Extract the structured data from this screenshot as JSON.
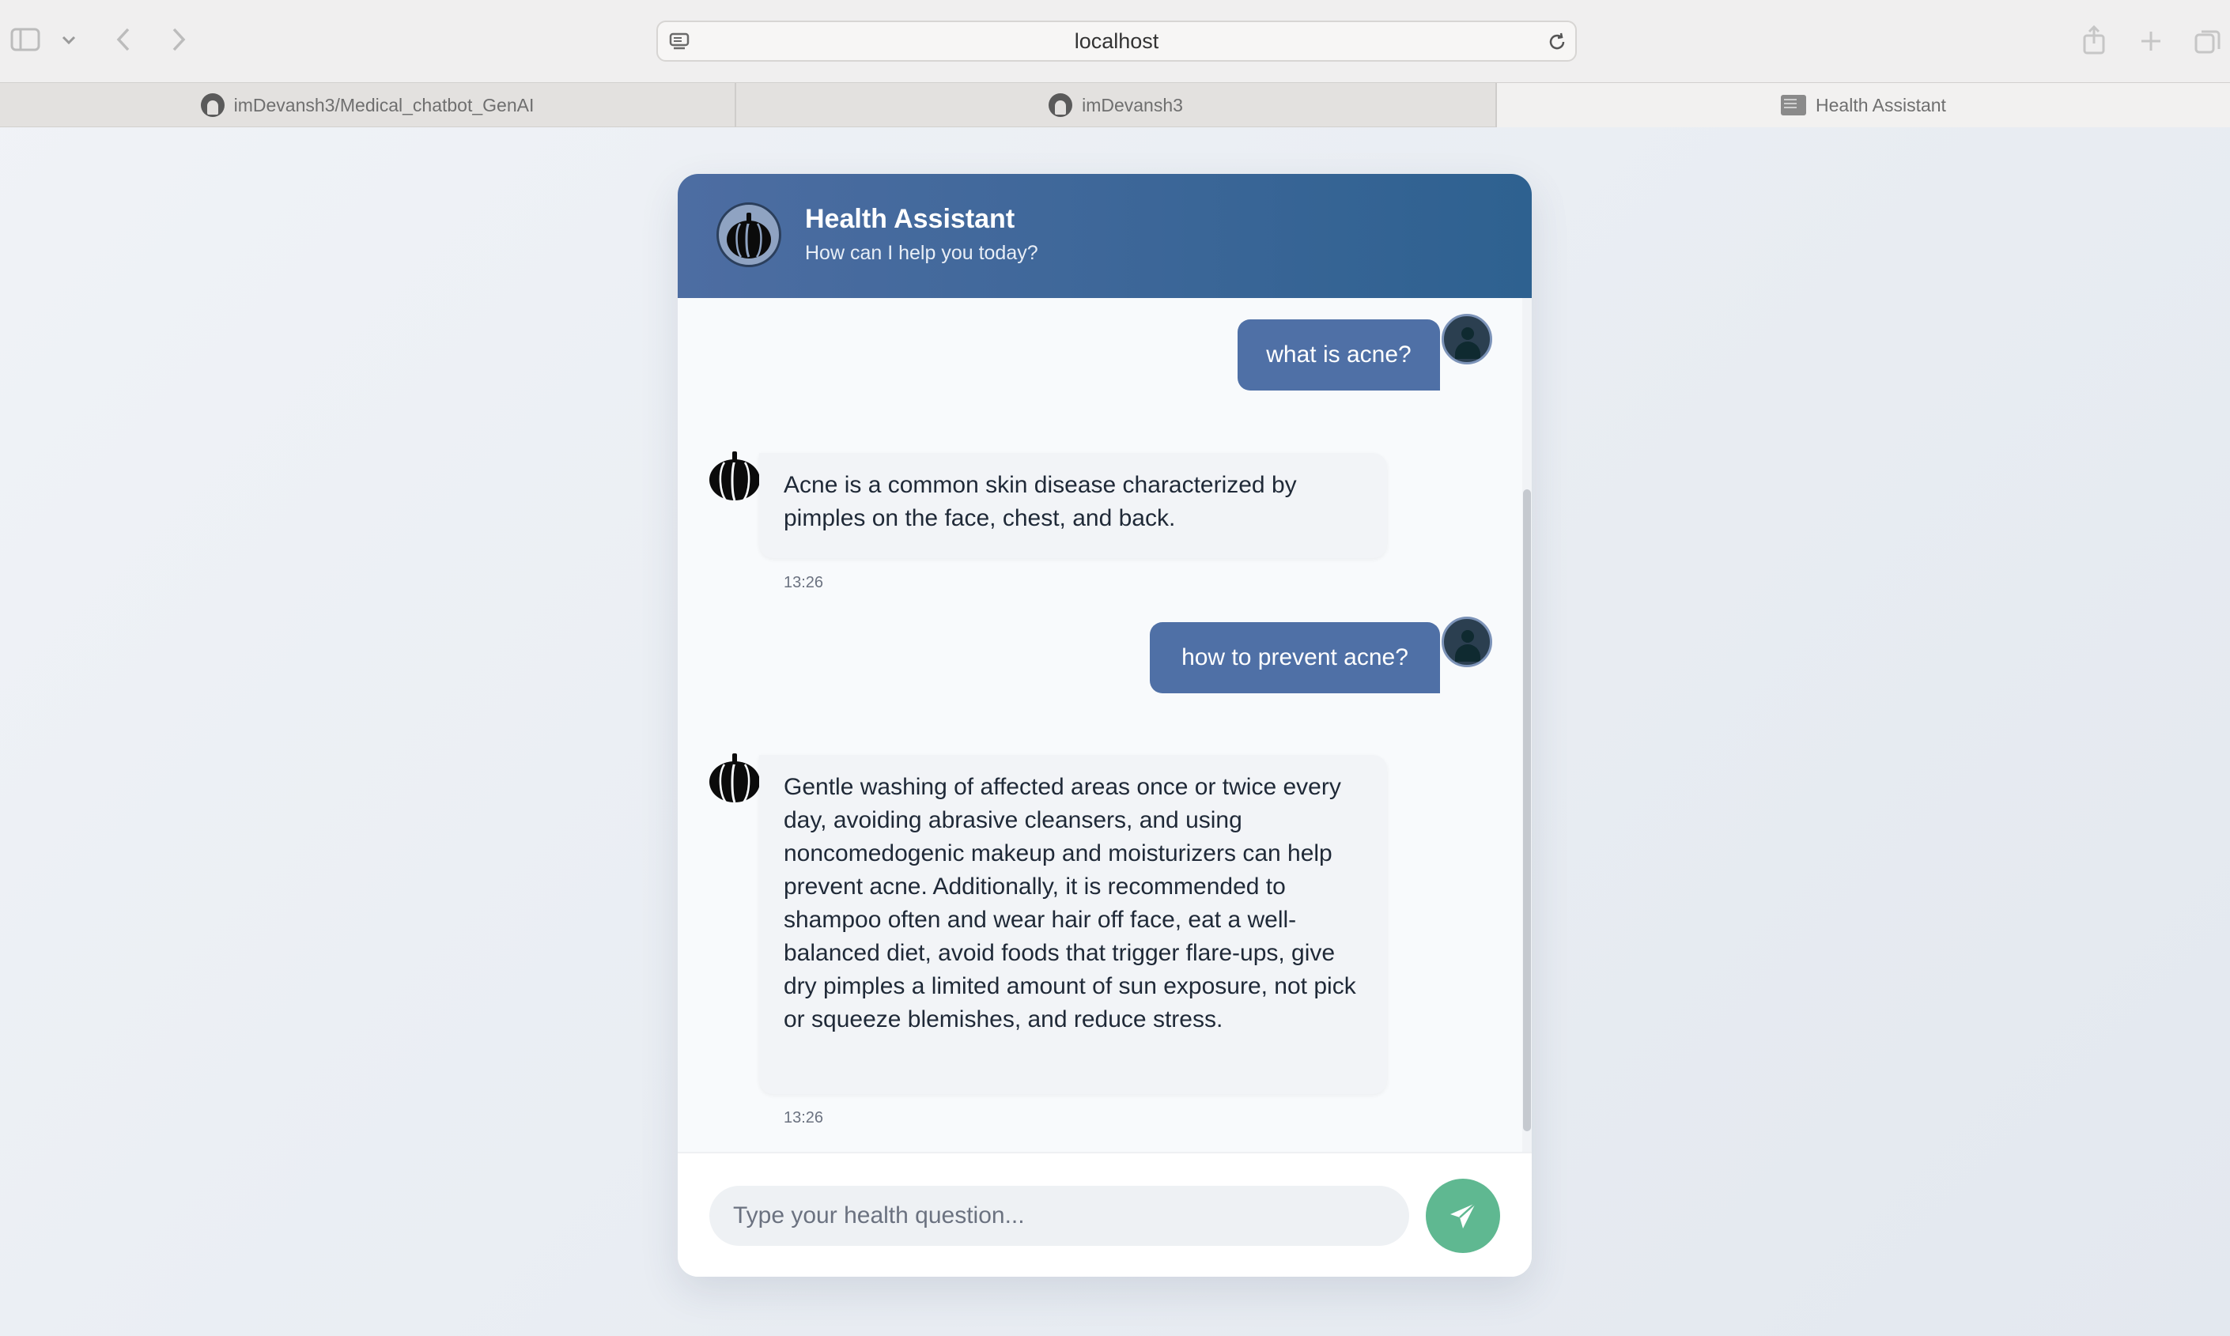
{
  "browser": {
    "url": "localhost",
    "tabs": [
      {
        "label": "imDevansh3/Medical_chatbot_GenAI",
        "icon": "github-icon"
      },
      {
        "label": "imDevansh3",
        "icon": "github-icon"
      },
      {
        "label": "Health Assistant",
        "icon": "page-favicon-icon"
      }
    ]
  },
  "chat": {
    "title": "Health Assistant",
    "subtitle": "How can I help you today?",
    "messages": [
      {
        "role": "user",
        "text": "what is acne?"
      },
      {
        "role": "bot",
        "text": "Acne is a common skin disease characterized by pimples on the face, chest, and back.",
        "time": "13:26"
      },
      {
        "role": "user",
        "text": "how to prevent acne?"
      },
      {
        "role": "bot",
        "text": "Gentle washing of affected areas once or twice every day, avoiding abrasive cleansers, and using noncomedogenic makeup and moisturizers can help prevent acne. Additionally, it is recommended to shampoo often and wear hair off face, eat a well-balanced diet, avoid foods that trigger flare-ups, give dry pimples a limited amount of sun exposure, not pick or squeeze blemishes, and reduce stress.",
        "time": "13:26"
      }
    ],
    "input": {
      "placeholder": "Type your health question...",
      "value": ""
    }
  },
  "colors": {
    "header_start": "#4d6da2",
    "header_end": "#2e6190",
    "user_bubble": "#4f70a6",
    "bot_bubble": "#f2f4f7",
    "send_button": "#5fb891"
  }
}
